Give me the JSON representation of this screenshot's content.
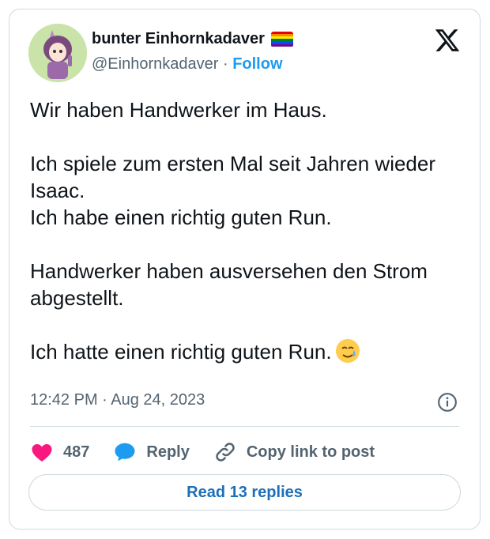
{
  "tweet": {
    "author_name": "bunter Einhornkadaver",
    "handle": "@Einhornkadaver",
    "separator": "·",
    "follow_label": "Follow",
    "text": "Wir haben Handwerker im Haus.\n\nIch spiele zum ersten Mal seit Jahren wieder Isaac.\nIch habe einen richtig guten Run.\n\nHandwerker haben ausversehen den Strom abgestellt.\n\nIch hatte einen richtig guten Run.",
    "timestamp": "12:42 PM · Aug 24, 2023"
  },
  "actions": {
    "likes": "487",
    "reply_label": "Reply",
    "copy_label": "Copy link to post"
  },
  "footer": {
    "read_replies_label": "Read 13 replies"
  },
  "icons": {
    "like": "heart-icon",
    "reply": "speech-bubble-icon",
    "copy": "link-icon",
    "logo": "x-logo-icon",
    "info": "info-icon",
    "emoji": "face-holding-back-tears-emoji"
  },
  "colors": {
    "like": "#f91880",
    "reply": "#1d9bf0",
    "follow": "#1d9bf0",
    "read": "#1d6fb8"
  }
}
